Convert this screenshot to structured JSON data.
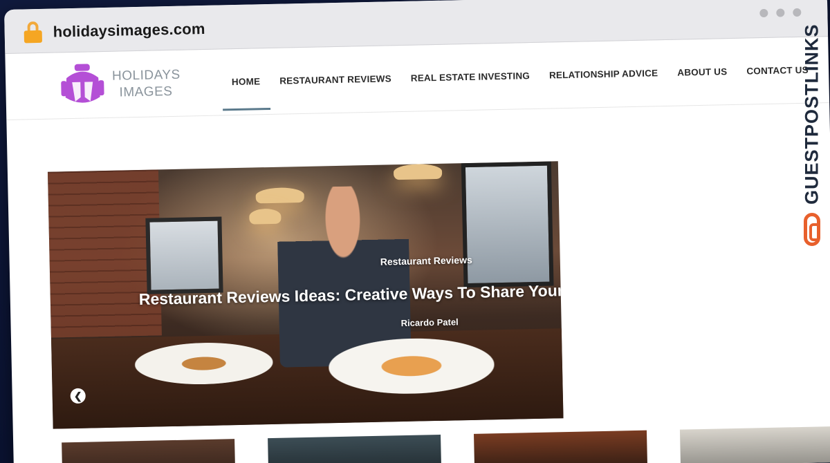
{
  "browser": {
    "url": "holidaysimages.com"
  },
  "site": {
    "logo_line1": "HOLIDAYS",
    "logo_line2": "IMAGES",
    "nav": [
      {
        "label": "HOME"
      },
      {
        "label": "RESTAURANT REVIEWS"
      },
      {
        "label": "REAL ESTATE INVESTING"
      },
      {
        "label": "RELATIONSHIP ADVICE"
      },
      {
        "label": "ABOUT US"
      },
      {
        "label": "CONTACT US"
      }
    ]
  },
  "hero": {
    "category": "Restaurant Reviews",
    "title": "Restaurant Reviews Ideas: Creative Ways To Share Your",
    "author": "Ricardo Patel",
    "prev_icon": "chevron-left-icon"
  },
  "side_brand": {
    "text": "GUESTPOSTLINKS",
    "icon": "link-chain-icon",
    "accent": "#e8602c"
  },
  "colors": {
    "logo_purple": "#b44fd6",
    "nav_active_underline": "#5b7a8c",
    "lock": "#f5a623"
  }
}
